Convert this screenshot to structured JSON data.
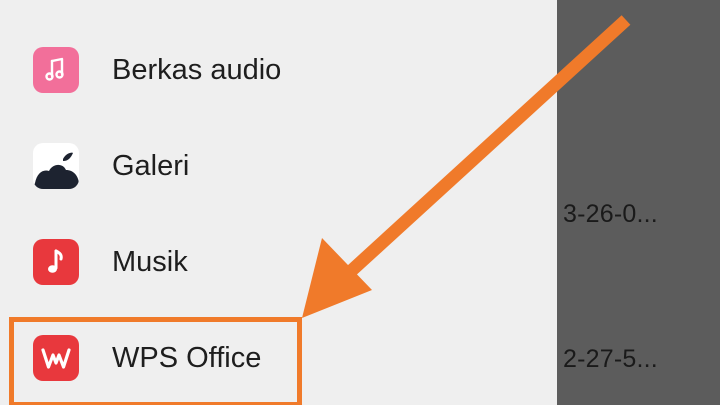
{
  "share_sheet": {
    "items": [
      {
        "label": "Berkas audio",
        "icon": "music-note-icon",
        "icon_color": "#f26f9a"
      },
      {
        "label": "Galeri",
        "icon": "gallery-icon",
        "icon_color": "#ffffff"
      },
      {
        "label": "Musik",
        "icon": "music-icon",
        "icon_color": "#e8383d"
      },
      {
        "label": "WPS Office",
        "icon": "wps-office-icon",
        "icon_color": "#e8383d"
      }
    ]
  },
  "background_list": {
    "items": [
      {
        "text": "3-26-0..."
      },
      {
        "text": "2-27-5..."
      }
    ]
  },
  "annotation": {
    "color": "#f07a2a",
    "target": "WPS Office"
  }
}
